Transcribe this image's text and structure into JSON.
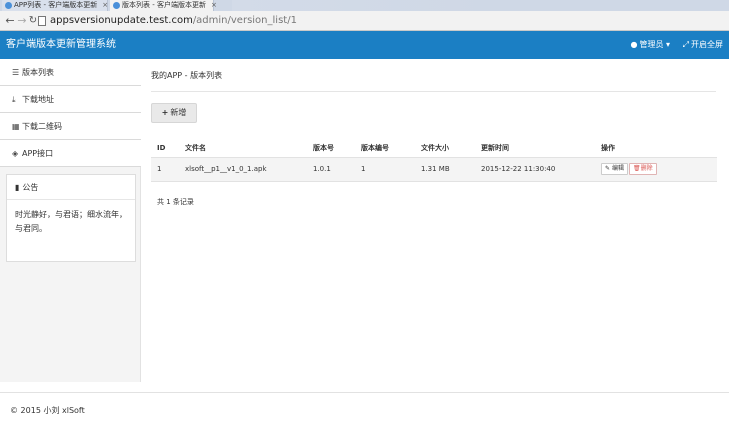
{
  "browser": {
    "tabs": [
      {
        "title": "APP列表 - 客户端版本更新",
        "active": false
      },
      {
        "title": "版本列表 - 客户端版本更新",
        "active": true
      }
    ],
    "close_glyph": "×",
    "url": {
      "host": "appsversionupdate.test.com",
      "path": "/admin/version_list/1"
    }
  },
  "header": {
    "brand": "客户端版本更新管理系统",
    "admin_menu": "管理员",
    "fullscreen": "开启全屏"
  },
  "sidebar": {
    "items": [
      {
        "label": "版本列表",
        "icon": "list-icon"
      },
      {
        "label": "下载地址",
        "icon": "download-icon"
      },
      {
        "label": "下载二维码",
        "icon": "qrcode-icon"
      },
      {
        "label": "APP接口",
        "icon": "cube-icon"
      }
    ],
    "notice": {
      "title": "公告",
      "body": "时光静好，与君语；细水流年，与君同。"
    }
  },
  "main": {
    "title": "我的APP - 版本列表",
    "add_button": "新增",
    "table": {
      "columns": [
        "ID",
        "文件名",
        "版本号",
        "版本编号",
        "文件大小",
        "更新时间",
        "操作"
      ],
      "rows": [
        {
          "id": "1",
          "filename": "xlsoft__p1__v1_0_1.apk",
          "version": "1.0.1",
          "version_code": "1",
          "size": "1.31 MB",
          "updated": "2015-12-22 11:30:40",
          "edit": "编辑",
          "delete": "删除"
        }
      ]
    },
    "record_count": "共 1 条记录"
  },
  "footer": {
    "copyright": "© 2015 小刘 xlSoft"
  },
  "colors": {
    "header_bg": "#1b7fc4",
    "delete": "#d9534f"
  }
}
